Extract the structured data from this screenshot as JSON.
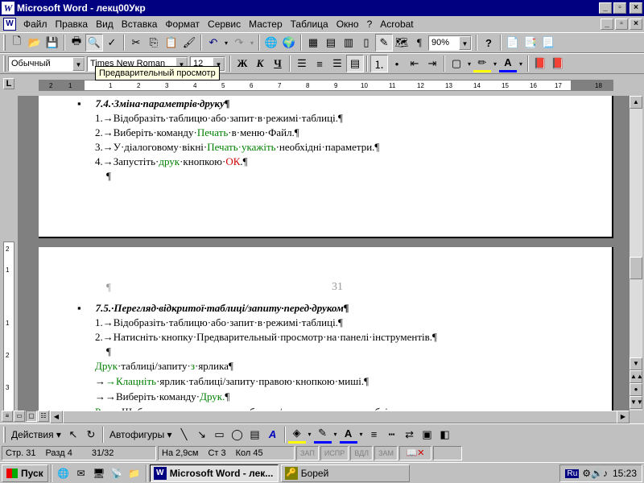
{
  "window": {
    "title": "Microsoft Word - лекц00Укр",
    "min_label": "_",
    "max_label": "▫",
    "close_label": "×"
  },
  "menu": {
    "items": [
      "Файл",
      "Правка",
      "Вид",
      "Вставка",
      "Формат",
      "Сервис",
      "Мастер",
      "Таблица",
      "Окно",
      "?",
      "Acrobat"
    ]
  },
  "toolbar": {
    "zoom": "90%"
  },
  "format_bar": {
    "style": "Обычный",
    "font": "Times New Roman",
    "size": "12",
    "bold": "Ж",
    "italic": "К",
    "underline": "Ч"
  },
  "tooltip": "Предварительный просмотр",
  "ruler": {
    "ticks": [
      "2",
      "1",
      "1",
      "2",
      "3",
      "4",
      "5",
      "6",
      "7",
      "8",
      "9",
      "10",
      "11",
      "12",
      "13",
      "14",
      "15",
      "16",
      "17",
      "18"
    ],
    "vticks": [
      "2",
      "1",
      "1",
      "2",
      "3"
    ]
  },
  "document": {
    "page1": {
      "heading": "7.4.·Зміна·параметрів·друку¶",
      "items": [
        {
          "num": "1.",
          "parts": [
            {
              "t": "→Відобразіть·таблицю·або·запит·в·режимі·таблиці.¶",
              "c": ""
            }
          ]
        },
        {
          "num": "2.",
          "parts": [
            {
              "t": "→Виберіть·команду·",
              "c": ""
            },
            {
              "t": "Печать",
              "c": "green"
            },
            {
              "t": "·в·меню·Файл.¶",
              "c": ""
            }
          ]
        },
        {
          "num": "3.",
          "parts": [
            {
              "t": "→У·діалоговому·вікні·",
              "c": ""
            },
            {
              "t": "Печать·укажіть",
              "c": "green"
            },
            {
              "t": "·необхідні·параметри.¶",
              "c": ""
            }
          ]
        },
        {
          "num": "4.",
          "parts": [
            {
              "t": "→Запустіть·",
              "c": ""
            },
            {
              "t": "друк",
              "c": "green"
            },
            {
              "t": "·кнопкою·",
              "c": ""
            },
            {
              "t": "ОК",
              "c": "red"
            },
            {
              "t": ".¶",
              "c": ""
            }
          ]
        }
      ],
      "trailing_pilcrow": "¶"
    },
    "page2": {
      "pilcrow": "¶",
      "page_number": "31",
      "heading": "7.5.·Перегляд·відкритої·таблиці/запиту·перед·друком¶",
      "items": [
        {
          "num": "1.",
          "parts": [
            {
              "t": "→Відобразіть·таблицю·або·запит·в·режимі·таблиці.¶",
              "c": ""
            }
          ]
        },
        {
          "num": "2.",
          "parts": [
            {
              "t": "→Натисніть·кнопку·Предварительный·просмотр·на·панелі·інструментів.¶",
              "c": ""
            }
          ]
        }
      ],
      "pilcrow2": "¶",
      "sub_lines": [
        {
          "parts": [
            {
              "t": "Друк",
              "c": "green"
            },
            {
              "t": "·таблиці/запиту·",
              "c": ""
            },
            {
              "t": "з",
              "c": "green"
            },
            {
              "t": "·ярлика¶",
              "c": ""
            }
          ]
        },
        {
          "parts": [
            {
              "t": "→",
              "c": ""
            },
            {
              "t": "→Клацніть",
              "c": "green"
            },
            {
              "t": "·ярлик·таблиці/запиту·правою·кнопкою·миші.¶",
              "c": ""
            }
          ]
        },
        {
          "parts": [
            {
              "t": "→→Виберіть·команду·",
              "c": ""
            },
            {
              "t": "Друк.",
              "c": "green"
            },
            {
              "t": "¶",
              "c": ""
            }
          ]
        },
        {
          "parts": [
            {
              "t": "Рада.",
              "c": "green"
            },
            {
              "t": "·Щоб·швидко·розпечатати·таблицю/запити·",
              "c": ""
            },
            {
              "t": "з",
              "c": "green"
            },
            {
              "t": "·ярлика,·необхідно·перетягнути·значок·",
              "c": ""
            }
          ]
        }
      ]
    }
  },
  "drawing_bar": {
    "actions_label": "Действия ▾",
    "autoshapes_label": "Автофигуры ▾"
  },
  "status": {
    "page": "Стр. 31",
    "section": "Разд 4",
    "pages": "31/32",
    "at": "На 2,9см",
    "line": "Ст 3",
    "col": "Кол 45",
    "rec": "ЗАП",
    "trk": "ИСПР",
    "ext": "ВДЛ",
    "ovr": "ЗАМ"
  },
  "taskbar": {
    "start": "Пуск",
    "tasks": [
      "Microsoft Word - лек...",
      "Борей"
    ],
    "lang": "Ru",
    "time": "15:23"
  }
}
